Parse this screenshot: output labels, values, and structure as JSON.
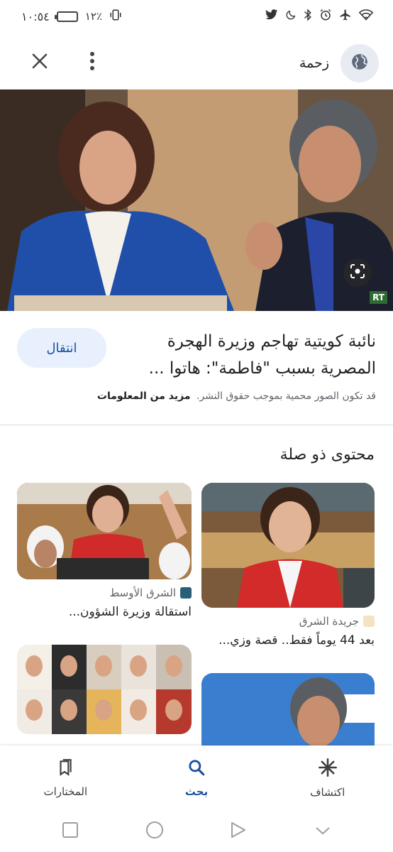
{
  "status_bar": {
    "time": "١٠:٥٤",
    "battery": "١٢٪",
    "icons": [
      "vibrate-icon",
      "battery-icon",
      "twitter-icon",
      "moon-icon",
      "bluetooth-icon",
      "alarm-icon",
      "airplane-icon",
      "wifi-icon"
    ]
  },
  "header": {
    "source_name": "زحمة",
    "close_icon": "close-icon",
    "more_icon": "more-vert-icon",
    "globe_icon": "globe-icon"
  },
  "hero": {
    "watermark": "RT",
    "lens_icon": "lens-icon"
  },
  "article": {
    "title": "نائبة كويتية تهاجم وزيرة الهجرة المصرية بسبب \"فاطمة\": هاتوا ...",
    "visit_label": "انتقال",
    "copyright_text": "قد تكون الصور محمية بموجب حقوق النشر.",
    "more_info_label": "مزيد من المعلومات"
  },
  "related": {
    "title": "محتوى ذو صلة",
    "cards": [
      {
        "source": "جريدة الشرق",
        "caption": "بعد 44 يوماً فقط.. قصة وزي..."
      },
      {
        "source": "الشرق الأوسط",
        "caption": "استقالة وزيرة الشؤون..."
      }
    ]
  },
  "bottom_nav": {
    "items": [
      {
        "label": "المختارات",
        "icon": "bookmarks-icon"
      },
      {
        "label": "بحث",
        "icon": "search-icon"
      },
      {
        "label": "اكتشاف",
        "icon": "discover-icon"
      }
    ]
  },
  "colors": {
    "accent": "#1a4fa0",
    "visit_bg": "#e8f0fe",
    "globe_bg": "#e8ecf2"
  }
}
